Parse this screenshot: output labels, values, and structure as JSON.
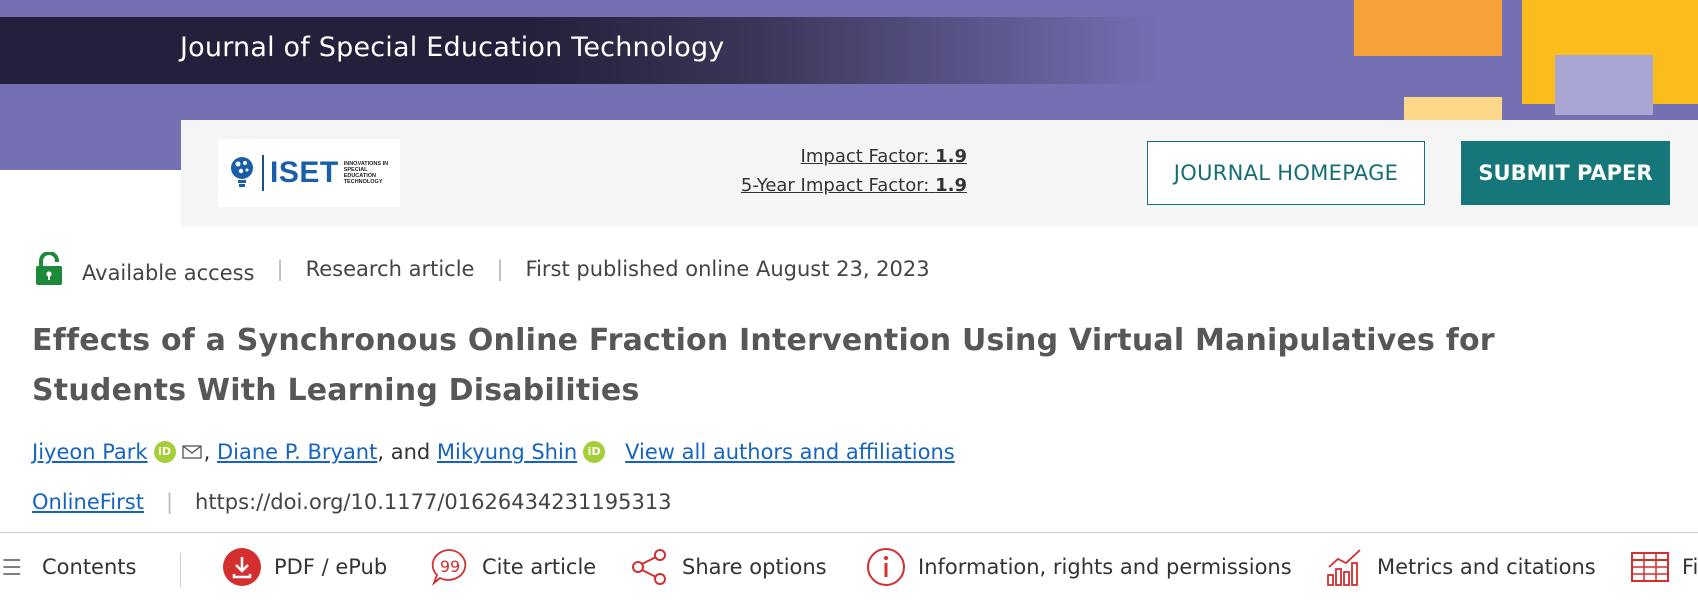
{
  "header": {
    "journal_title": "Journal of Special Education Technology",
    "logo_text": "ISET",
    "logo_subtext": "INNOVATIONS IN SPECIAL EDUCATION TECHNOLOGY",
    "impact_factor_label": "Impact Factor:",
    "impact_factor_value": "1.9",
    "five_year_label": "5-Year Impact Factor:",
    "five_year_value": "1.9",
    "journal_homepage_label": "JOURNAL HOMEPAGE",
    "submit_paper_label": "SUBMIT PAPER"
  },
  "meta": {
    "access": "Available access",
    "type": "Research article",
    "published": "First published online August 23, 2023"
  },
  "article": {
    "title": "Effects of a Synchronous Online Fraction Intervention Using Virtual Manipulatives for Students With Learning Disabilities",
    "authors": [
      {
        "name": "Jiyeon Park"
      },
      {
        "name": "Diane P. Bryant"
      },
      {
        "name": "Mikyung Shin"
      }
    ],
    "and_text": "and",
    "view_all": "View all authors and affiliations",
    "issue_link": "OnlineFirst",
    "doi": "https://doi.org/10.1177/01626434231195313"
  },
  "toolbar": {
    "contents": "Contents",
    "pdf": "PDF / ePub",
    "cite": "Cite article",
    "share": "Share options",
    "info": "Information, rights and permissions",
    "metrics": "Metrics and citations",
    "figures": "Fi"
  },
  "colors": {
    "banner": "#7570b3",
    "teal": "#16777a",
    "link": "#1565c0",
    "orcid": "#a6ce39",
    "red_icon": "#d32f2f",
    "lock_green": "#1b8a3a"
  }
}
